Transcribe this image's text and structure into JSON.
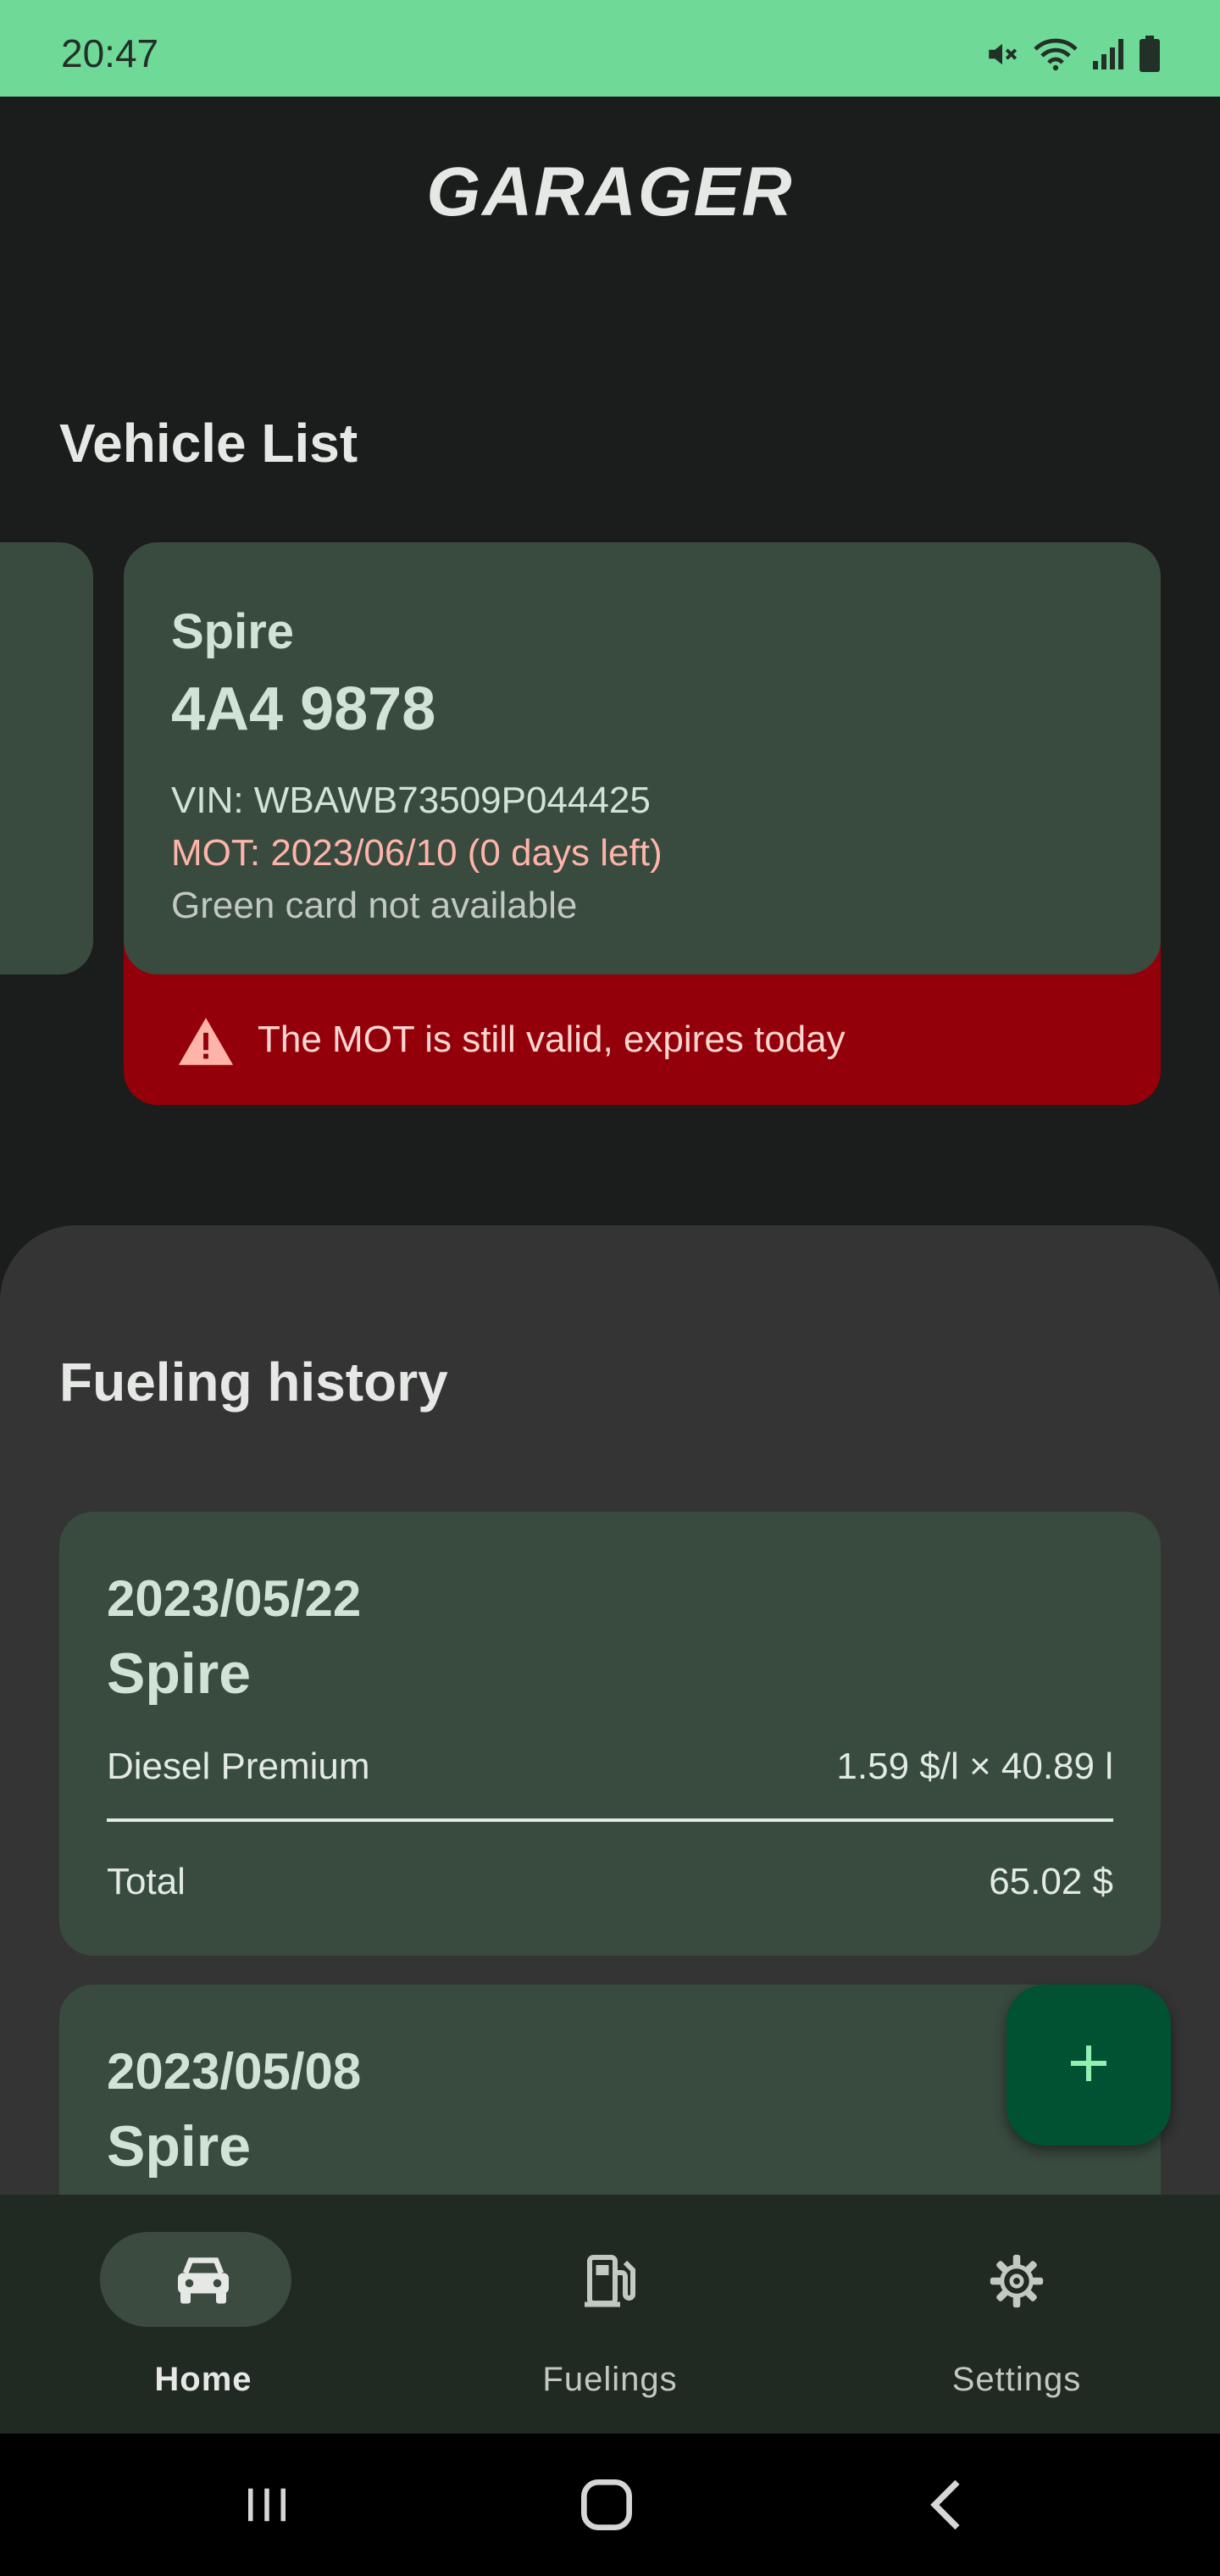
{
  "status_bar": {
    "time": "20:47",
    "icons": [
      "mute-icon",
      "wifi-icon",
      "signal-icon",
      "battery-icon"
    ]
  },
  "app": {
    "title": "GARAGER"
  },
  "vehicles": {
    "section_title": "Vehicle List",
    "current": {
      "name": "Spire",
      "plate": "4A4 9878",
      "vin": "VIN: WBAWB73509P044425",
      "mot": "MOT: 2023/06/10 (0 days left)",
      "green_card": "Green card not available",
      "alert": "The MOT is still valid, expires today"
    }
  },
  "fuelings": {
    "section_title": "Fueling history",
    "items": [
      {
        "date": "2023/05/22",
        "vehicle": "Spire",
        "fuel": "Diesel Premium",
        "price": "1.59 $/l × 40.89 l",
        "total_label": "Total",
        "total_value": "65.02 $"
      },
      {
        "date": "2023/05/08",
        "vehicle": "Spire"
      }
    ]
  },
  "fab": {
    "icon": "plus-icon"
  },
  "bottom_nav": {
    "items": [
      {
        "label": "Home",
        "icon": "car-icon",
        "active": true
      },
      {
        "label": "Fuelings",
        "icon": "fuel-pump-icon",
        "active": false
      },
      {
        "label": "Settings",
        "icon": "gear-icon",
        "active": false
      }
    ]
  },
  "colors": {
    "status_bar": "#6fda98",
    "background": "#1b1d1c",
    "card": "#394a3f",
    "alert": "#930009",
    "mot_text": "#ffb4a9",
    "fab": "#005233",
    "nav": "#202a23"
  }
}
